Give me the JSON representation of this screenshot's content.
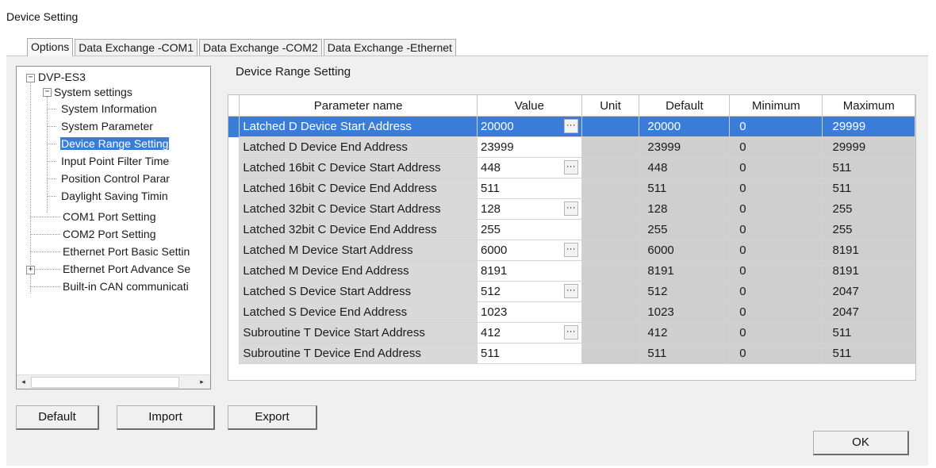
{
  "window": {
    "title": "Device Setting"
  },
  "tabs": [
    {
      "label": "Options",
      "active": true
    },
    {
      "label": "Data Exchange -COM1",
      "active": false
    },
    {
      "label": "Data Exchange -COM2",
      "active": false
    },
    {
      "label": "Data Exchange -Ethernet",
      "active": false
    }
  ],
  "tree": {
    "root": "DVP-ES3",
    "system_settings": "System settings",
    "system_children": [
      "System Information",
      "System Parameter",
      "Device Range Setting",
      "Input Point Filter Time",
      "Position Control Parar",
      "Daylight Saving Timin"
    ],
    "selected": "Device Range Setting",
    "other_items": [
      "COM1 Port Setting",
      "COM2 Port Setting",
      "Ethernet Port Basic Settin",
      "Ethernet Port Advance Se",
      "Built-in CAN communicati"
    ],
    "expander_collapse": "−",
    "expander_expand": "+"
  },
  "main": {
    "section_title": "Device Range Setting",
    "columns": [
      "Parameter name",
      "Value",
      "Unit",
      "Default",
      "Minimum",
      "Maximum"
    ],
    "rows": [
      {
        "name": "Latched D Device Start Address",
        "value": "20000",
        "has_ellipsis": true,
        "unit": "",
        "default": "20000",
        "min": "0",
        "max": "29999",
        "selected": true
      },
      {
        "name": "Latched D Device End Address",
        "value": "23999",
        "has_ellipsis": false,
        "unit": "",
        "default": "23999",
        "min": "0",
        "max": "29999"
      },
      {
        "name": "Latched 16bit C Device Start Address",
        "value": "448",
        "has_ellipsis": true,
        "unit": "",
        "default": "448",
        "min": "0",
        "max": "511"
      },
      {
        "name": "Latched 16bit C Device End Address",
        "value": "511",
        "has_ellipsis": false,
        "unit": "",
        "default": "511",
        "min": "0",
        "max": "511"
      },
      {
        "name": "Latched 32bit C Device Start Address",
        "value": "128",
        "has_ellipsis": true,
        "unit": "",
        "default": "128",
        "min": "0",
        "max": "255"
      },
      {
        "name": "Latched 32bit C Device End Address",
        "value": "255",
        "has_ellipsis": false,
        "unit": "",
        "default": "255",
        "min": "0",
        "max": "255"
      },
      {
        "name": "Latched M Device Start Address",
        "value": "6000",
        "has_ellipsis": true,
        "unit": "",
        "default": "6000",
        "min": "0",
        "max": "8191"
      },
      {
        "name": "Latched M Device End Address",
        "value": "8191",
        "has_ellipsis": false,
        "unit": "",
        "default": "8191",
        "min": "0",
        "max": "8191"
      },
      {
        "name": "Latched S Device Start Address",
        "value": "512",
        "has_ellipsis": true,
        "unit": "",
        "default": "512",
        "min": "0",
        "max": "2047"
      },
      {
        "name": "Latched S Device End Address",
        "value": "1023",
        "has_ellipsis": false,
        "unit": "",
        "default": "1023",
        "min": "0",
        "max": "2047"
      },
      {
        "name": "Subroutine T Device Start Address",
        "value": "412",
        "has_ellipsis": true,
        "unit": "",
        "default": "412",
        "min": "0",
        "max": "511"
      },
      {
        "name": "Subroutine T Device End Address",
        "value": "511",
        "has_ellipsis": false,
        "unit": "",
        "default": "511",
        "min": "0",
        "max": "511"
      }
    ],
    "ellipsis": "···"
  },
  "buttons": {
    "default": "Default",
    "import": "Import",
    "export": "Export",
    "ok": "OK"
  },
  "scroll": {
    "left_arrow": "◂",
    "right_arrow": "▸"
  },
  "colors": {
    "selection": "#3a7dd8",
    "readonly_cell": "#cfcfcf"
  }
}
